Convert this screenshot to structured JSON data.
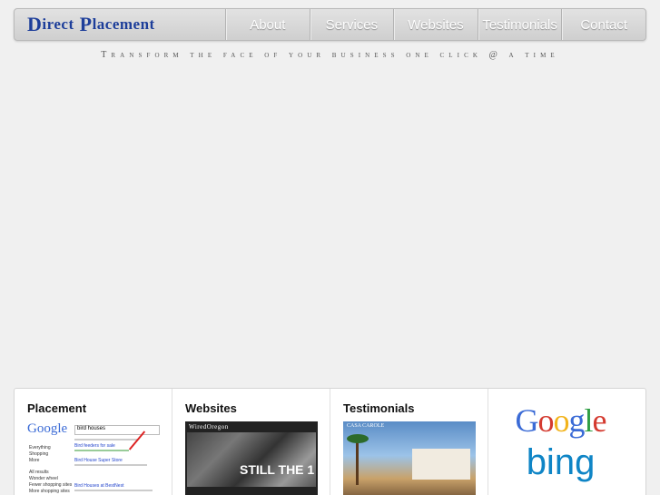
{
  "brand": {
    "first_letter_1": "D",
    "rest_1": "irect",
    "first_letter_2": "P",
    "rest_2": "lacement"
  },
  "nav": [
    "About",
    "Services",
    "Websites",
    "Testimonials",
    "Contact"
  ],
  "tagline": "Transform the face of your business one click @ a time",
  "panel": {
    "placement": {
      "title": "Placement",
      "thumb": {
        "logo": "Google",
        "query": "bird houses",
        "results": [
          "Bird feeders for sale",
          "Bird House Super Store",
          "Bird Houses at BestNest"
        ],
        "sidebar": [
          "Everything",
          "Shopping",
          "More",
          "All results",
          "Wonder wheel",
          "Fewer shopping sites",
          "More shopping sites"
        ]
      }
    },
    "websites": {
      "title": "Websites",
      "thumb": {
        "logo": "WiredOregon",
        "headline": "STILL THE 1"
      }
    },
    "testimonials": {
      "title": "Testimonials",
      "thumb": {
        "logo": "CASA CAROLE"
      }
    },
    "engines": {
      "google": "Google",
      "bing": "bing"
    }
  },
  "colors": {
    "brand": "#1d3e9a",
    "bing": "#0f85c6"
  }
}
